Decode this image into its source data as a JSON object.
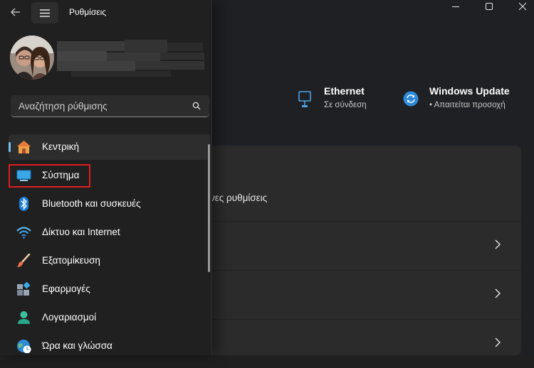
{
  "window": {
    "title": "Ρυθμίσεις",
    "controls": [
      "minimize",
      "maximize",
      "close"
    ]
  },
  "status": {
    "ethernet": {
      "title": "Ethernet",
      "subtitle": "Σε σύνδεση"
    },
    "windows_update": {
      "title": "Windows Update",
      "subtitle": "• Απαιτείται προσοχή"
    }
  },
  "main_card": {
    "partial_text": "νες ρυθμίσεις"
  },
  "search": {
    "placeholder": "Αναζήτηση ρύθμισης"
  },
  "nav": {
    "items": [
      {
        "label": "Κεντρική",
        "icon": "home-icon",
        "selected": true
      },
      {
        "label": "Σύστημα",
        "icon": "system-icon",
        "selected": false,
        "highlighted": true
      },
      {
        "label": "Bluetooth και συσκευές",
        "icon": "bluetooth-icon",
        "selected": false
      },
      {
        "label": "Δίκτυο και Internet",
        "icon": "wifi-icon",
        "selected": false
      },
      {
        "label": "Εξατομίκευση",
        "icon": "brush-icon",
        "selected": false
      },
      {
        "label": "Εφαρμογές",
        "icon": "apps-icon",
        "selected": false
      },
      {
        "label": "Λογαριασμοί",
        "icon": "account-icon",
        "selected": false
      },
      {
        "label": "Ώρα και γλώσσα",
        "icon": "globe-clock-icon",
        "selected": false
      }
    ]
  },
  "colors": {
    "accent": "#78bef0",
    "highlight_box": "#e01d1d",
    "nav_background": "#202020",
    "card_background": "#2b2b2b"
  }
}
